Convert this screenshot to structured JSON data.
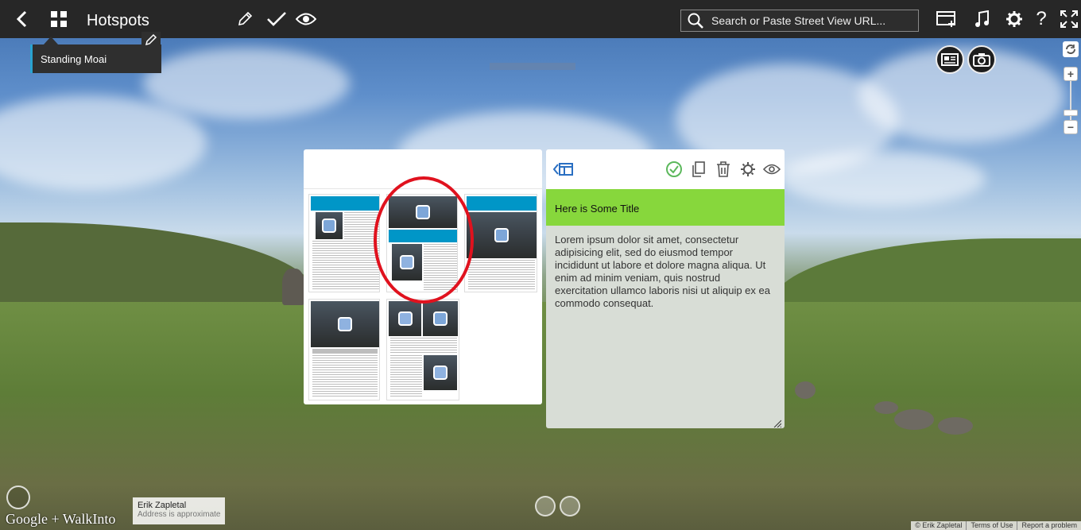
{
  "topbar": {
    "title": "Hotspots",
    "search_placeholder": "Search or Paste Street View URL..."
  },
  "hotspot": {
    "label": "Standing Moai"
  },
  "editor": {
    "title": "Here is Some Title",
    "body": "Lorem ipsum dolor sit amet, consectetur adipisicing elit, sed do eiusmod tempor incididunt ut labore et dolore magna aliqua. Ut enim ad minim veniam, quis nostrud exercitation ullamco laboris nisi ut aliquip ex ea commodo consequat."
  },
  "footer": {
    "brand": "Google + WalkInto",
    "author_name": "Erik Zapletal",
    "author_note": "Address is approximate",
    "links": [
      "© Erik Zapletal",
      "Terms of Use",
      "Report a problem"
    ]
  },
  "colors": {
    "accent_blue": "#0096c7",
    "title_green": "#87d73c",
    "highlight_red": "#e0121e",
    "topbar": "#272727"
  }
}
